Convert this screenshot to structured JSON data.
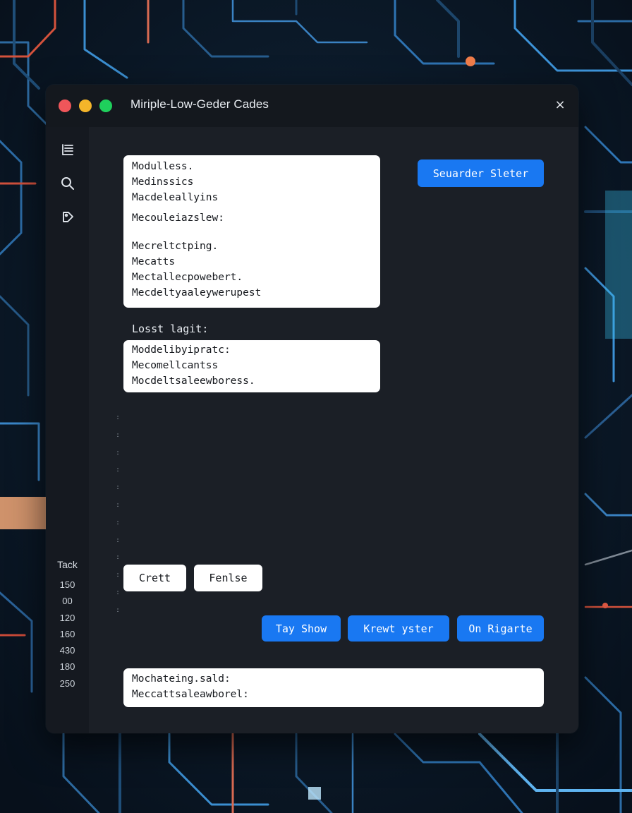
{
  "window": {
    "title": "Miriple-Low-Geder Cades",
    "close_glyph": "×"
  },
  "sidebar": {
    "icons": [
      "list-icon",
      "search-icon",
      "tag-icon"
    ],
    "track": {
      "title": "Tack",
      "values": [
        "150",
        "00",
        "120",
        "160",
        "430",
        "180",
        "250"
      ]
    }
  },
  "top_card": {
    "lines": [
      "Modulless.",
      "Medinssics",
      "Macdeleallyins",
      "Mecouleiazslew:",
      "Mecreltctping.",
      "Mecatts",
      "Mectallecpowebert.",
      "Mecdeltyaaleywerupest"
    ]
  },
  "primary_button": {
    "label": "Seuarder Sleter"
  },
  "section": {
    "label": "Losst lagit:"
  },
  "mid_card": {
    "lines": [
      "Moddelibyipratc:",
      "Mecomellcantss",
      "Mocdeltsaleewboress."
    ]
  },
  "gutter_marker": ":",
  "small_buttons": [
    {
      "label": "Crett"
    },
    {
      "label": "Fenlse"
    }
  ],
  "action_buttons": [
    {
      "label": "Tay Show"
    },
    {
      "label": "Krewt yster"
    },
    {
      "label": "On Rigarte"
    }
  ],
  "bottom_card": {
    "lines": [
      "Mochateing.sald:",
      "Meccattsaleawborel:"
    ],
    "close_glyph": "×"
  },
  "colors": {
    "accent": "#1978f2",
    "window_bg": "#1b1f26",
    "titlebar_bg": "#14181e",
    "traffic_red": "#f0565a",
    "traffic_yellow": "#f4b52a",
    "traffic_green": "#1fd05c"
  }
}
